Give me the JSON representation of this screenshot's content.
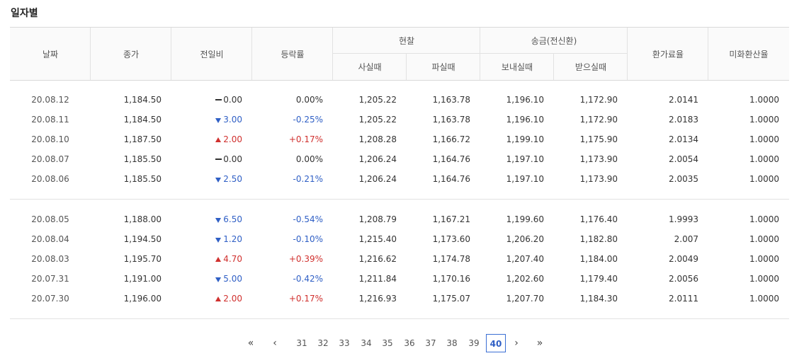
{
  "title": "일자별",
  "headers": {
    "date": "날짜",
    "close": "종가",
    "change": "전일비",
    "rate": "등락률",
    "cash": "현찰",
    "cash_buy": "사실때",
    "cash_sell": "파실때",
    "wire": "송금(전신환)",
    "wire_send": "보내실때",
    "wire_receive": "받으실때",
    "conv_rate": "환가료율",
    "usd_rate": "미화환산율"
  },
  "groups": [
    {
      "rows": [
        {
          "date": "20.08.12",
          "close": "1,184.50",
          "dir": "flat",
          "change": "0.00",
          "rate": "0.00%",
          "cash_buy": "1,205.22",
          "cash_sell": "1,163.78",
          "wire_send": "1,196.10",
          "wire_receive": "1,172.90",
          "conv_rate": "2.0141",
          "usd_rate": "1.0000"
        },
        {
          "date": "20.08.11",
          "close": "1,184.50",
          "dir": "down",
          "change": "3.00",
          "rate": "-0.25%",
          "cash_buy": "1,205.22",
          "cash_sell": "1,163.78",
          "wire_send": "1,196.10",
          "wire_receive": "1,172.90",
          "conv_rate": "2.0183",
          "usd_rate": "1.0000"
        },
        {
          "date": "20.08.10",
          "close": "1,187.50",
          "dir": "up",
          "change": "2.00",
          "rate": "+0.17%",
          "cash_buy": "1,208.28",
          "cash_sell": "1,166.72",
          "wire_send": "1,199.10",
          "wire_receive": "1,175.90",
          "conv_rate": "2.0134",
          "usd_rate": "1.0000"
        },
        {
          "date": "20.08.07",
          "close": "1,185.50",
          "dir": "flat",
          "change": "0.00",
          "rate": "0.00%",
          "cash_buy": "1,206.24",
          "cash_sell": "1,164.76",
          "wire_send": "1,197.10",
          "wire_receive": "1,173.90",
          "conv_rate": "2.0054",
          "usd_rate": "1.0000"
        },
        {
          "date": "20.08.06",
          "close": "1,185.50",
          "dir": "down",
          "change": "2.50",
          "rate": "-0.21%",
          "cash_buy": "1,206.24",
          "cash_sell": "1,164.76",
          "wire_send": "1,197.10",
          "wire_receive": "1,173.90",
          "conv_rate": "2.0035",
          "usd_rate": "1.0000"
        }
      ]
    },
    {
      "rows": [
        {
          "date": "20.08.05",
          "close": "1,188.00",
          "dir": "down",
          "change": "6.50",
          "rate": "-0.54%",
          "cash_buy": "1,208.79",
          "cash_sell": "1,167.21",
          "wire_send": "1,199.60",
          "wire_receive": "1,176.40",
          "conv_rate": "1.9993",
          "usd_rate": "1.0000"
        },
        {
          "date": "20.08.04",
          "close": "1,194.50",
          "dir": "down",
          "change": "1.20",
          "rate": "-0.10%",
          "cash_buy": "1,215.40",
          "cash_sell": "1,173.60",
          "wire_send": "1,206.20",
          "wire_receive": "1,182.80",
          "conv_rate": "2.007",
          "usd_rate": "1.0000"
        },
        {
          "date": "20.08.03",
          "close": "1,195.70",
          "dir": "up",
          "change": "4.70",
          "rate": "+0.39%",
          "cash_buy": "1,216.62",
          "cash_sell": "1,174.78",
          "wire_send": "1,207.40",
          "wire_receive": "1,184.00",
          "conv_rate": "2.0049",
          "usd_rate": "1.0000"
        },
        {
          "date": "20.07.31",
          "close": "1,191.00",
          "dir": "down",
          "change": "5.00",
          "rate": "-0.42%",
          "cash_buy": "1,211.84",
          "cash_sell": "1,170.16",
          "wire_send": "1,202.60",
          "wire_receive": "1,179.40",
          "conv_rate": "2.0056",
          "usd_rate": "1.0000"
        },
        {
          "date": "20.07.30",
          "close": "1,196.00",
          "dir": "up",
          "change": "2.00",
          "rate": "+0.17%",
          "cash_buy": "1,216.93",
          "cash_sell": "1,175.07",
          "wire_send": "1,207.70",
          "wire_receive": "1,184.30",
          "conv_rate": "2.0111",
          "usd_rate": "1.0000"
        }
      ]
    }
  ],
  "pagination": {
    "first": "«",
    "prev": "‹",
    "pages": [
      "31",
      "32",
      "33",
      "34",
      "35",
      "36",
      "37",
      "38",
      "39",
      "40"
    ],
    "current": "40",
    "next": "›",
    "last": "»"
  },
  "colors": {
    "up": "#d0302e",
    "down": "#2f5fc5",
    "border": "#e2e2e2"
  },
  "icons": {
    "up": "triangle-up-icon",
    "down": "triangle-down-icon",
    "flat": "dash-icon"
  }
}
